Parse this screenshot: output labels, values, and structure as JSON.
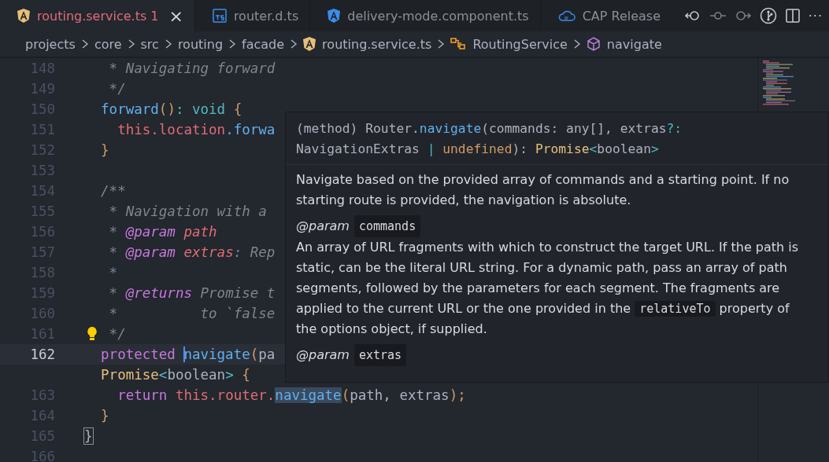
{
  "tabs": [
    {
      "label": "routing.service.ts",
      "selected": true,
      "problems": "1",
      "close": "×"
    },
    {
      "label": "router.d.ts",
      "selected": false
    },
    {
      "label": "delivery-mode.component.ts",
      "selected": false
    },
    {
      "label": "CAP Release",
      "selected": false
    }
  ],
  "toolbar": {
    "more": "···"
  },
  "breadcrumb": [
    {
      "label": "projects"
    },
    {
      "label": "core"
    },
    {
      "label": "src"
    },
    {
      "label": "routing"
    },
    {
      "label": "facade"
    },
    {
      "label": "routing.service.ts"
    },
    {
      "label": "RoutingService"
    },
    {
      "label": "navigate"
    }
  ],
  "code_lines": [
    {
      "number": "148",
      "current": false,
      "tokens": [
        {
          "kind": "comment",
          "text": "   * Navigating forward"
        }
      ]
    },
    {
      "number": "149",
      "current": false,
      "tokens": [
        {
          "kind": "comment",
          "text": "   */"
        }
      ]
    },
    {
      "number": "150",
      "current": false,
      "tokens": [
        {
          "kind": "function",
          "text": "  forward"
        },
        {
          "kind": "bracket",
          "text": "()"
        },
        {
          "kind": "operator",
          "text": ": void "
        },
        {
          "kind": "bracket",
          "text": "{"
        }
      ]
    },
    {
      "number": "151",
      "current": false,
      "tokens": [
        {
          "kind": "variable",
          "text": "    this.location"
        },
        {
          "kind": "function",
          "text": ".forwa"
        }
      ]
    },
    {
      "number": "152",
      "current": false,
      "tokens": [
        {
          "kind": "bracket",
          "text": "  }"
        }
      ]
    },
    {
      "number": "153",
      "current": false
    },
    {
      "number": "154",
      "current": false,
      "tokens": [
        {
          "kind": "comment",
          "text": "  /**"
        }
      ]
    },
    {
      "number": "155",
      "current": false,
      "tokens": [
        {
          "kind": "comment",
          "text": "   * Navigation with a"
        }
      ]
    },
    {
      "number": "156",
      "current": false,
      "tokens": [
        {
          "kind": "comment",
          "text": "   * "
        },
        {
          "kind": "tag",
          "text": "@param "
        },
        {
          "kind": "param",
          "text": "path"
        }
      ]
    },
    {
      "number": "157",
      "current": false,
      "tokens": [
        {
          "kind": "comment",
          "text": "   * "
        },
        {
          "kind": "tag",
          "text": "@param "
        },
        {
          "kind": "param",
          "text": "extras"
        },
        {
          "kind": "comment",
          "text": ": Rep"
        }
      ]
    },
    {
      "number": "158",
      "current": false,
      "tokens": [
        {
          "kind": "comment",
          "text": "   *"
        }
      ]
    },
    {
      "number": "159",
      "current": false,
      "tokens": [
        {
          "kind": "comment",
          "text": "   * "
        },
        {
          "kind": "tag",
          "text": "@returns"
        },
        {
          "kind": "comment",
          "text": " Promise t"
        }
      ]
    },
    {
      "number": "160",
      "current": false,
      "tokens": [
        {
          "kind": "comment",
          "text": "   *          to `false"
        }
      ]
    },
    {
      "number": "161",
      "current": false,
      "lightbulb": true,
      "tokens": [
        {
          "kind": "comment",
          "text": "   */"
        }
      ]
    },
    {
      "number": "162",
      "current": true,
      "tokens": [
        {
          "kind": "keyword",
          "text": "  protected "
        },
        {
          "kind": "function",
          "text": "navigate",
          "cursor": true
        },
        {
          "kind": "bracket",
          "text": "("
        },
        {
          "kind": "plain",
          "text": "pa"
        }
      ]
    },
    {
      "tokens": [
        {
          "kind": "type",
          "text": "  Promise"
        },
        {
          "kind": "operator",
          "text": "<"
        },
        {
          "kind": "plain",
          "text": "boolean"
        },
        {
          "kind": "operator",
          "text": "> "
        },
        {
          "kind": "bracket",
          "text": "{"
        }
      ]
    },
    {
      "number": "163",
      "current": false,
      "tokens": [
        {
          "kind": "keyword",
          "text": "    return "
        },
        {
          "kind": "variable",
          "text": "this.router."
        },
        {
          "kind": "function",
          "text": "navigate",
          "highlighted": true
        },
        {
          "kind": "bracket",
          "text": "("
        },
        {
          "kind": "plain",
          "text": "path, extras"
        },
        {
          "kind": "bracket",
          "text": ");"
        }
      ]
    },
    {
      "number": "164",
      "current": false,
      "tokens": [
        {
          "kind": "bracket",
          "text": "  }"
        }
      ]
    },
    {
      "number": "165",
      "current": false,
      "tokens": [
        {
          "kind": "plain",
          "text": "}",
          "matched": true
        }
      ]
    },
    {
      "number": "166",
      "current": false
    }
  ],
  "hover": {
    "signature": [
      [
        {
          "kind": "plain",
          "text": "(method) Router."
        },
        {
          "kind": "function",
          "text": "navigate"
        },
        {
          "kind": "plain",
          "text": "(commands: any[], extras"
        },
        {
          "kind": "operator",
          "text": "?:"
        }
      ],
      [
        {
          "kind": "plain",
          "text": "NavigationExtras "
        },
        {
          "kind": "operator",
          "text": "| "
        },
        {
          "kind": "number",
          "text": "undefined"
        },
        {
          "kind": "plain",
          "text": "): "
        },
        {
          "kind": "type",
          "text": "Promise"
        },
        {
          "kind": "operator",
          "text": "<"
        },
        {
          "kind": "plain",
          "text": "boolean"
        },
        {
          "kind": "operator",
          "text": ">"
        }
      ]
    ],
    "docs": [
      {
        "kind": "text",
        "segments": [
          {
            "kind": "text",
            "text": "Navigate based on the provided array of commands and a starting point. If no starting route is provided, the navigation is absolute."
          }
        ]
      },
      {
        "kind": "param",
        "tag": "@param",
        "name": "commands"
      },
      {
        "kind": "text",
        "segments": [
          {
            "kind": "text",
            "text": "An array of URL fragments with which to construct the target URL. If the path is static, can be the literal URL string. For a dynamic path, pass an array of path segments, followed by the parameters for each segment. The fragments are applied to the current URL or the one provided in the "
          },
          {
            "kind": "code",
            "text": "relativeTo"
          },
          {
            "kind": "text",
            "text": " property of the options object, if supplied."
          }
        ]
      },
      {
        "kind": "param",
        "tag": "@param",
        "name": "extras"
      }
    ]
  }
}
